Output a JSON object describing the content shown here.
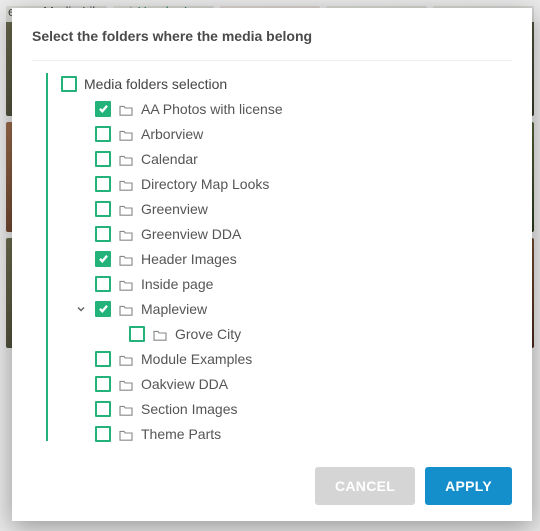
{
  "breadcrumbs": {
    "a": "ero",
    "b": "Media Library",
    "c": "Header Images"
  },
  "modal": {
    "title": "Select the folders where the media belong",
    "root_label": "Media folders selection",
    "root_checked": false,
    "folders": [
      {
        "label": "AA Photos with license",
        "checked": true
      },
      {
        "label": "Arborview",
        "checked": false
      },
      {
        "label": "Calendar",
        "checked": false
      },
      {
        "label": "Directory Map Looks",
        "checked": false
      },
      {
        "label": "Greenview",
        "checked": false
      },
      {
        "label": "Greenview DDA",
        "checked": false
      },
      {
        "label": "Header Images",
        "checked": true
      },
      {
        "label": "Inside page",
        "checked": false
      },
      {
        "label": "Mapleview",
        "checked": true,
        "expanded": true,
        "children": [
          {
            "label": "Grove City",
            "checked": false
          }
        ]
      },
      {
        "label": "Module Examples",
        "checked": false
      },
      {
        "label": "Oakview DDA",
        "checked": false
      },
      {
        "label": "Section Images",
        "checked": false
      },
      {
        "label": "Theme Parts",
        "checked": false
      }
    ],
    "cancel_label": "CANCEL",
    "apply_label": "APPLY"
  }
}
